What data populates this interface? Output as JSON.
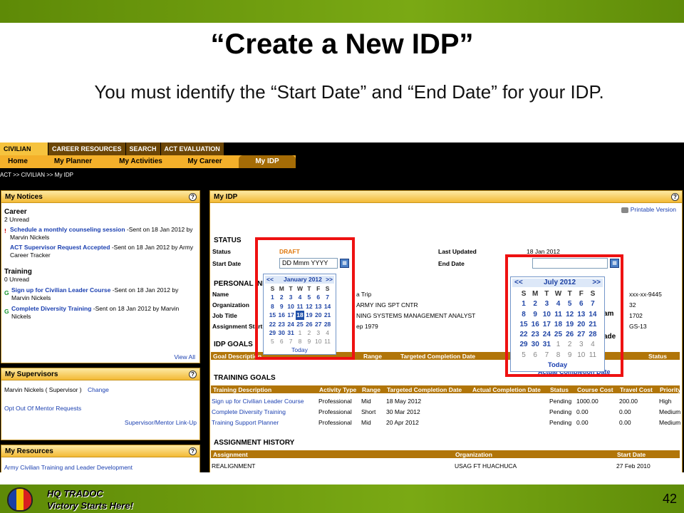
{
  "slide": {
    "title": "“Create a New IDP”",
    "subtitle": "You must identify the “Start Date” and “End Date” for your IDP.",
    "page_number": "42",
    "footer_line1": "HQ TRADOC",
    "footer_line2": "Victory Starts Here!"
  },
  "tabs": [
    "CIVILIAN",
    "CAREER RESOURCES",
    "SEARCH",
    "ACT EVALUATION"
  ],
  "nav": [
    "Home",
    "My Planner",
    "My Activities",
    "My Career",
    "My IDP"
  ],
  "breadcrumb": "ACT >> CIVILIAN >> My IDP",
  "notices": {
    "title": "My Notices",
    "career_head": "Career",
    "career_unread": "2 Unread",
    "n1_link": "Schedule a monthly counseling session",
    "n1_text": " -Sent on 18 Jan 2012 by Marvin Nickels",
    "n2_link": "ACT Supervisor Request Accepted",
    "n2_text": " -Sent on 18 Jan 2012 by Army Career Tracker",
    "training_head": "Training",
    "training_unread": "0 Unread",
    "t1_link": "Sign up for Civilian Leader Course",
    "t1_text": " -Sent on 18 Jan 2012 by Marvin Nickels",
    "t2_link": "Complete Diversity Training",
    "t2_text": " -Sent on 18 Jan 2012 by Marvin Nickels",
    "view_all": "View All",
    "mark_excl": "!",
    "mark_g": "G"
  },
  "supervisors": {
    "title": "My Supervisors",
    "line": "Marvin Nickels ( Supervisor )",
    "change": "Change",
    "opt_out": "Opt Out Of Mentor Requests",
    "link_up": "Supervisor/Mentor Link-Up"
  },
  "resources": {
    "title": "My Resources",
    "item": "Army Civilian Training and Leader Development"
  },
  "idp": {
    "title": "My IDP",
    "printable": "Printable Version",
    "status_head": "STATUS",
    "status_label": "Status",
    "status_value": "DRAFT",
    "start_label": "Start Date",
    "start_placeholder": "DD Mmm YYYY",
    "last_updated_label": "Last Updated",
    "last_updated_value": "18 Jan 2012",
    "end_label": "End Date",
    "personal_head": "PERSONAL INF",
    "name_label": "Name",
    "org_label": "Organization",
    "job_label": "Job Title",
    "assign_label": "Assignment Start",
    "name_val": "a Trip",
    "org_val": "ARMY ING SPT CNTR",
    "job_val": "NING SYSTEMS MANAGEMENT ANALYST",
    "assign_val": "ep 1979",
    "ssn": "xxx-xx-9445",
    "r2": "32",
    "r3": "1702",
    "r4": "GS-13",
    "am_frag": "am",
    "ade_frag": "ade",
    "idp_goals_head": "IDP GOALS",
    "goal_cols": [
      "Goal Description",
      "Range",
      "Targeted Completion Date",
      "Status"
    ],
    "act_comp_frag": "Actual Completion Date",
    "training_goals_head": "TRAINING GOALS",
    "tg_cols": [
      "Training Description",
      "Activity Type",
      "Range",
      "Targeted Completion Date",
      "Actual Completion Date",
      "Status",
      "Course Cost",
      "Travel Cost",
      "Priority"
    ],
    "tg_rows": [
      [
        "Sign up for Civilian Leader Course",
        "Professional",
        "Mid",
        "18 May 2012",
        "",
        "Pending",
        "1000.00",
        "200.00",
        "High"
      ],
      [
        "Complete Diversity Training",
        "Professional",
        "Short",
        "30 Mar 2012",
        "",
        "Pending",
        "0.00",
        "0.00",
        "Medium"
      ],
      [
        "Training Support Planner",
        "Professional",
        "Mid",
        "20 Apr 2012",
        "",
        "Pending",
        "0.00",
        "0.00",
        "Medium"
      ]
    ],
    "ah_head": "ASSIGNMENT HISTORY",
    "ah_cols": [
      "Assignment",
      "Organization",
      "Start Date"
    ],
    "ah_row": [
      "REALIGNMENT",
      "USAG FT HUACHUCA",
      "27 Feb 2010"
    ]
  },
  "cal_jan": {
    "prev": "<<",
    "next": ">>",
    "month": "January 2012",
    "days": [
      "S",
      "M",
      "T",
      "W",
      "T",
      "F",
      "S"
    ],
    "weeks": [
      [
        "",
        "",
        "",
        "",
        "",
        "",
        ""
      ],
      [
        "1",
        "2",
        "3",
        "4",
        "5",
        "6",
        "7"
      ],
      [
        "8",
        "9",
        "10",
        "11",
        "12",
        "13",
        "14"
      ],
      [
        "15",
        "16",
        "17",
        "18",
        "19",
        "20",
        "21"
      ],
      [
        "22",
        "23",
        "24",
        "25",
        "26",
        "27",
        "28"
      ],
      [
        "29",
        "30",
        "31",
        "1",
        "2",
        "3",
        "4"
      ],
      [
        "5",
        "6",
        "7",
        "8",
        "9",
        "10",
        "11"
      ]
    ],
    "today": "Today"
  },
  "cal_jul": {
    "prev": "<<",
    "next": ">>",
    "month": "July 2012",
    "days": [
      "S",
      "M",
      "T",
      "W",
      "T",
      "F",
      "S"
    ],
    "weeks": [
      [
        "1",
        "2",
        "3",
        "4",
        "5",
        "6",
        "7"
      ],
      [
        "8",
        "9",
        "10",
        "11",
        "12",
        "13",
        "14"
      ],
      [
        "15",
        "16",
        "17",
        "18",
        "19",
        "20",
        "21"
      ],
      [
        "22",
        "23",
        "24",
        "25",
        "26",
        "27",
        "28"
      ],
      [
        "29",
        "30",
        "31",
        "1",
        "2",
        "3",
        "4"
      ],
      [
        "5",
        "6",
        "7",
        "8",
        "9",
        "10",
        "11"
      ]
    ],
    "today": "Today"
  },
  "colors": {
    "accent": "#f4b02a",
    "tab_dark": "#6c4606",
    "header_brown": "#b17509",
    "link": "#1a3fb0",
    "highlight": "#ee1111",
    "green_bar": "#7aa914"
  }
}
